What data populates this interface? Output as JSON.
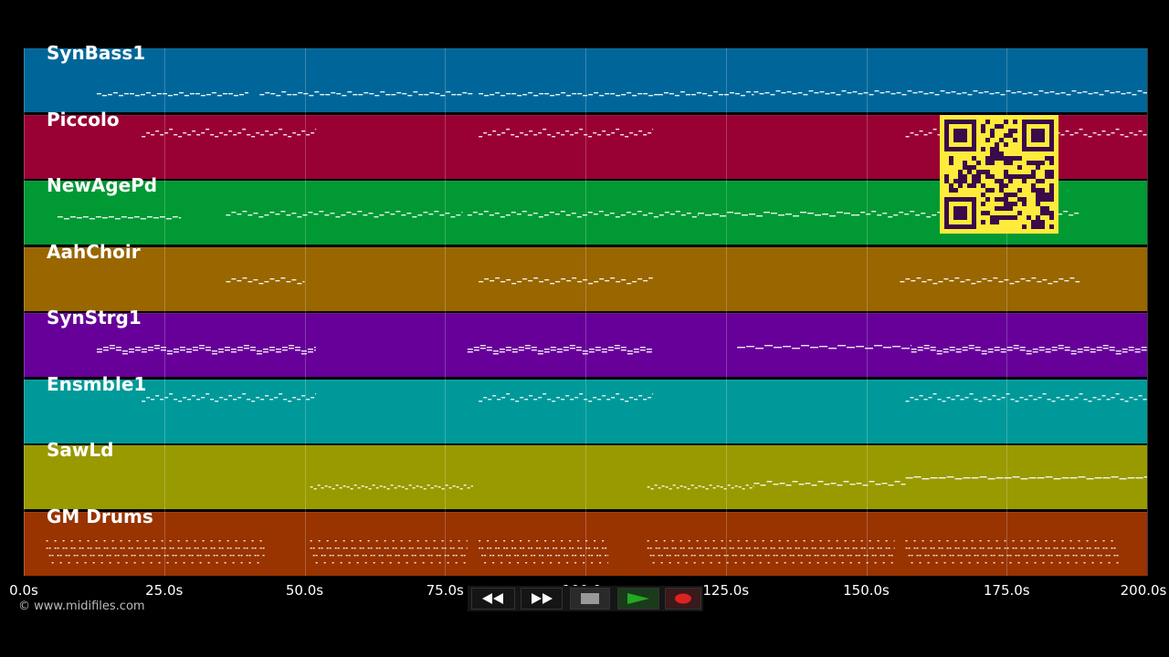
{
  "tracks": [
    {
      "name": "SynBass1",
      "color": "#006699",
      "segments": [
        [
          13,
          40,
          0
        ],
        [
          42,
          80,
          1
        ],
        [
          81,
          113,
          0
        ],
        [
          113,
          130,
          1
        ],
        [
          130,
          200,
          2
        ]
      ]
    },
    {
      "name": "Piccolo",
      "color": "#990033",
      "segments": [
        [
          21,
          52,
          3
        ],
        [
          81,
          112,
          3
        ],
        [
          157,
          200,
          3
        ]
      ]
    },
    {
      "name": "NewAgePd",
      "color": "#009933",
      "segments": [
        [
          6,
          28,
          4
        ],
        [
          36,
          78,
          5
        ],
        [
          79,
          120,
          5
        ],
        [
          120,
          148,
          6
        ],
        [
          148,
          188,
          5
        ]
      ]
    },
    {
      "name": "AahChoir",
      "color": "#996600",
      "segments": [
        [
          36,
          50,
          5
        ],
        [
          81,
          112,
          5
        ],
        [
          156,
          188,
          5
        ]
      ]
    },
    {
      "name": "SynStrg1",
      "color": "#660099",
      "segments": [
        [
          13,
          52,
          7
        ],
        [
          79,
          112,
          7
        ],
        [
          127,
          158,
          8
        ],
        [
          158,
          200,
          7
        ]
      ]
    },
    {
      "name": "Ensmble1",
      "color": "#009999",
      "segments": [
        [
          21,
          52,
          3
        ],
        [
          81,
          112,
          3
        ],
        [
          157,
          200,
          3
        ]
      ]
    },
    {
      "name": "SawLd",
      "color": "#999900",
      "segments": [
        [
          51,
          80,
          9
        ],
        [
          111,
          130,
          9
        ],
        [
          130,
          157,
          10
        ],
        [
          157,
          200,
          11
        ]
      ]
    },
    {
      "name": "GM Drums",
      "color": "#993300",
      "segments": [
        [
          4,
          43,
          12
        ],
        [
          51,
          79,
          12
        ],
        [
          81,
          104,
          12
        ],
        [
          111,
          155,
          12
        ],
        [
          157,
          195,
          12
        ]
      ]
    }
  ],
  "timeline": {
    "ticks": [
      "0.0s",
      "25.0s",
      "50.0s",
      "75.0s",
      "100.0s",
      "125.0s",
      "150.0s",
      "175.0s",
      "200.0s"
    ],
    "max_seconds": 200
  },
  "copyright": "© www.midifiles.com",
  "transport": {
    "rewind_icon": "rewind-icon",
    "forward_icon": "fast-forward-icon",
    "stop_icon": "stop-icon",
    "play_icon": "play-icon",
    "record_icon": "record-icon",
    "play_color": "#22aa22",
    "record_color": "#dd2222"
  },
  "overlay": {
    "icon": "qr-code-icon",
    "color": "#ffeb3b"
  }
}
